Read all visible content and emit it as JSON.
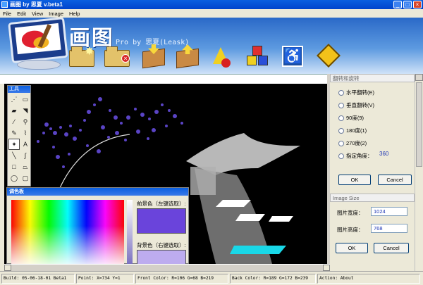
{
  "window": {
    "title": "画图 by 思夏 v.beta1"
  },
  "menu": [
    "File",
    "Edit",
    "View",
    "Image",
    "Help"
  ],
  "banner": {
    "brand": "画图",
    "subtitle": "Pro by 思夏(Leask)"
  },
  "toolbar": {
    "icons": [
      "new-file-icon",
      "close-file-icon",
      "import-box-icon",
      "export-box-icon",
      "shapes-icon",
      "cubes-icon",
      "accessibility-icon",
      "warning-diamond-icon"
    ]
  },
  "toolbox": {
    "title": "工具",
    "tools": [
      "select-free-icon",
      "select-rect-icon",
      "eraser-icon",
      "fill-icon",
      "color-picker-icon",
      "magnifier-icon",
      "pencil-icon",
      "brush-icon",
      "airbrush-icon",
      "text-icon",
      "line-icon",
      "curve-icon",
      "rectangle-icon",
      "polygon-icon",
      "ellipse-icon",
      "rounded-rect-icon"
    ],
    "text_tool_label": "A"
  },
  "palette": {
    "title": "调色板",
    "fg_label": "前景色（左键选取）:",
    "bg_label": "背景色（右键选取）:",
    "fg_color": "#6a44db",
    "bg_color": "#bdacef"
  },
  "flip_panel": {
    "title": "翻转和旋转",
    "options": [
      "水平翻转(E)",
      "垂直翻转(V)",
      "90度(9)",
      "180度(1)",
      "270度(2)",
      "指定角度："
    ],
    "angle_value": "360",
    "ok": "OK",
    "cancel": "Cancel"
  },
  "size_panel": {
    "title": "Image Size",
    "width_label": "图片宽度：",
    "width_value": "1024",
    "height_label": "图片高度：",
    "height_value": "768",
    "ok": "OK",
    "cancel": "Cancel"
  },
  "status": {
    "build": "Build: 05-06-18-01 Beta1",
    "point": "Point: X=734 Y=1",
    "front_color": "Front Color: R=106 G=68 B=219",
    "back_color": "Back Color: R=189 G=172 B=239",
    "action": "Action: About"
  }
}
